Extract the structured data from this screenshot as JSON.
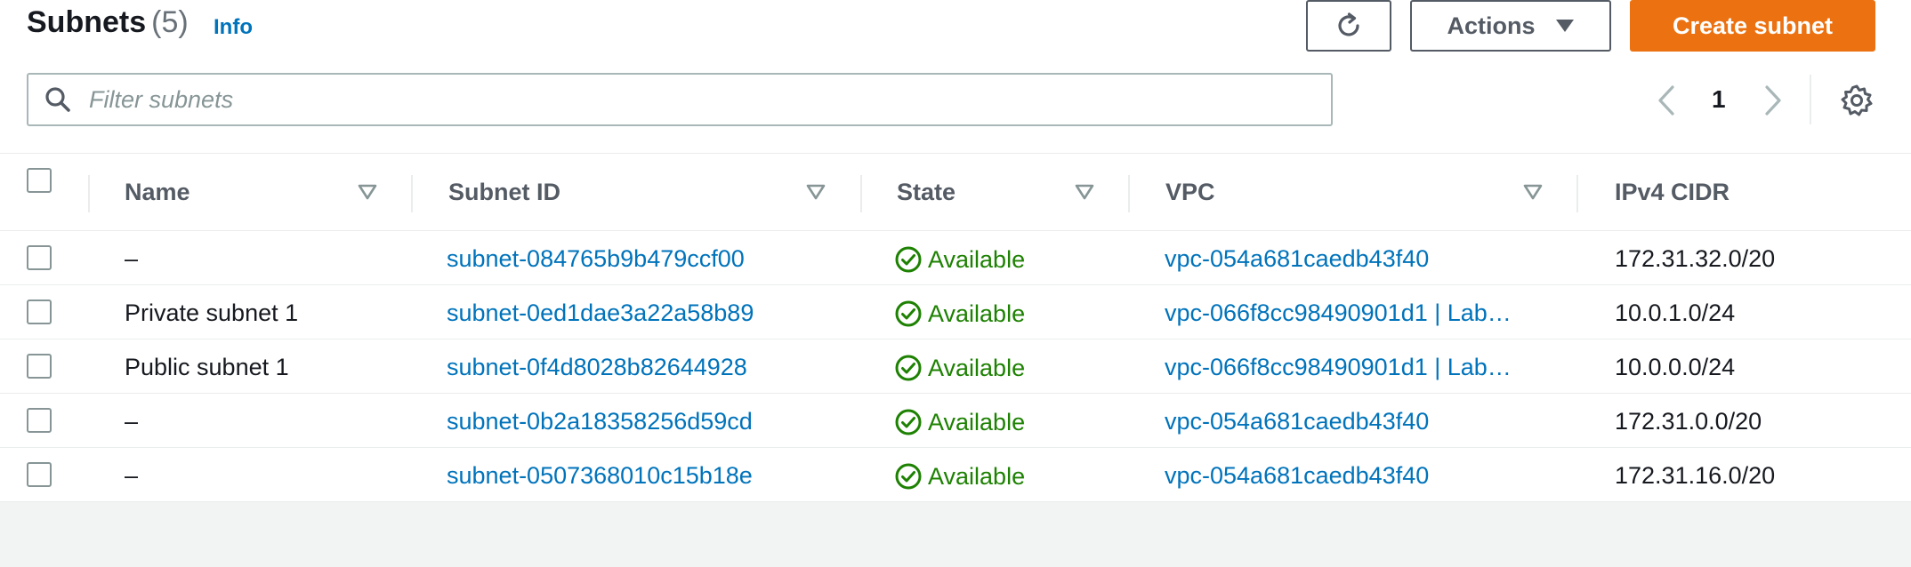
{
  "header": {
    "title": "Subnets",
    "count": "(5)",
    "info": "Info"
  },
  "toolbar": {
    "actions_label": "Actions",
    "create_label": "Create subnet"
  },
  "search": {
    "placeholder": "Filter subnets",
    "value": ""
  },
  "pagination": {
    "current_page": "1"
  },
  "table": {
    "columns": [
      "Name",
      "Subnet ID",
      "State",
      "VPC",
      "IPv4 CIDR"
    ],
    "rows": [
      {
        "name": "–",
        "subnet_id": "subnet-084765b9b479ccf00",
        "state": "Available",
        "vpc": "vpc-054a681caedb43f40",
        "cidr": "172.31.32.0/20"
      },
      {
        "name": "Private subnet 1",
        "subnet_id": "subnet-0ed1dae3a22a58b89",
        "state": "Available",
        "vpc": "vpc-066f8cc98490901d1 | Lab…",
        "cidr": "10.0.1.0/24"
      },
      {
        "name": "Public subnet 1",
        "subnet_id": "subnet-0f4d8028b82644928",
        "state": "Available",
        "vpc": "vpc-066f8cc98490901d1 | Lab…",
        "cidr": "10.0.0.0/24"
      },
      {
        "name": "–",
        "subnet_id": "subnet-0b2a18358256d59cd",
        "state": "Available",
        "vpc": "vpc-054a681caedb43f40",
        "cidr": "172.31.0.0/20"
      },
      {
        "name": "–",
        "subnet_id": "subnet-0507368010c15b18e",
        "state": "Available",
        "vpc": "vpc-054a681caedb43f40",
        "cidr": "172.31.16.0/20"
      }
    ]
  },
  "icons": {
    "refresh": "refresh-icon",
    "actions_caret": "caret-down-icon",
    "search": "search-icon",
    "prev": "chevron-left-icon",
    "next": "chevron-right-icon",
    "settings": "gear-icon",
    "sort": "sort-caret-icon",
    "status": "check-circle-icon"
  },
  "colors": {
    "primary_button": "#ec7211",
    "link": "#0073bb",
    "status_available": "#1d8102"
  }
}
